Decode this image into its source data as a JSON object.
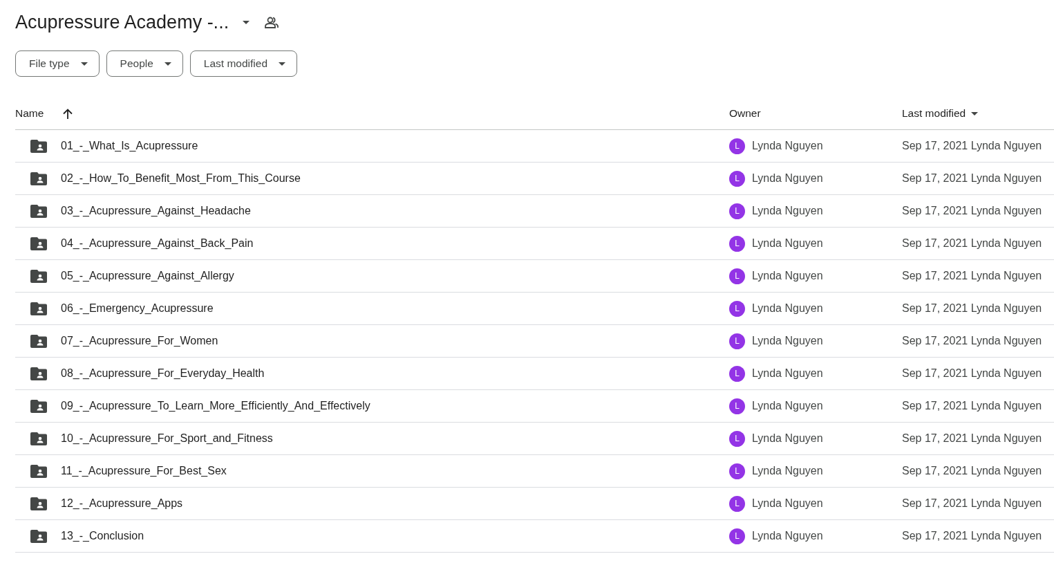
{
  "header": {
    "title": "Acupressure Academy -..."
  },
  "filters": [
    {
      "label": "File type"
    },
    {
      "label": "People"
    },
    {
      "label": "Last modified"
    }
  ],
  "table": {
    "columns": [
      "Name",
      "Owner",
      "Last modified"
    ],
    "rows": [
      {
        "name": "01_-_What_Is_Acupressure",
        "owner_initial": "L",
        "owner": "Lynda Nguyen",
        "last_modified": "Sep 17, 2021 Lynda Nguyen"
      },
      {
        "name": "02_-_How_To_Benefit_Most_From_This_Course",
        "owner_initial": "L",
        "owner": "Lynda Nguyen",
        "last_modified": "Sep 17, 2021 Lynda Nguyen"
      },
      {
        "name": "03_-_Acupressure_Against_Headache",
        "owner_initial": "L",
        "owner": "Lynda Nguyen",
        "last_modified": "Sep 17, 2021 Lynda Nguyen"
      },
      {
        "name": "04_-_Acupressure_Against_Back_Pain",
        "owner_initial": "L",
        "owner": "Lynda Nguyen",
        "last_modified": "Sep 17, 2021 Lynda Nguyen"
      },
      {
        "name": "05_-_Acupressure_Against_Allergy",
        "owner_initial": "L",
        "owner": "Lynda Nguyen",
        "last_modified": "Sep 17, 2021 Lynda Nguyen"
      },
      {
        "name": "06_-_Emergency_Acupressure",
        "owner_initial": "L",
        "owner": "Lynda Nguyen",
        "last_modified": "Sep 17, 2021 Lynda Nguyen"
      },
      {
        "name": "07_-_Acupressure_For_Women",
        "owner_initial": "L",
        "owner": "Lynda Nguyen",
        "last_modified": "Sep 17, 2021 Lynda Nguyen"
      },
      {
        "name": "08_-_Acupressure_For_Everyday_Health",
        "owner_initial": "L",
        "owner": "Lynda Nguyen",
        "last_modified": "Sep 17, 2021 Lynda Nguyen"
      },
      {
        "name": "09_-_Acupressure_To_Learn_More_Efficiently_And_Effectively",
        "owner_initial": "L",
        "owner": "Lynda Nguyen",
        "last_modified": "Sep 17, 2021 Lynda Nguyen"
      },
      {
        "name": "10_-_Acupressure_For_Sport_and_Fitness",
        "owner_initial": "L",
        "owner": "Lynda Nguyen",
        "last_modified": "Sep 17, 2021 Lynda Nguyen"
      },
      {
        "name": "11_-_Acupressure_For_Best_Sex",
        "owner_initial": "L",
        "owner": "Lynda Nguyen",
        "last_modified": "Sep 17, 2021 Lynda Nguyen"
      },
      {
        "name": "12_-_Acupressure_Apps",
        "owner_initial": "L",
        "owner": "Lynda Nguyen",
        "last_modified": "Sep 17, 2021 Lynda Nguyen"
      },
      {
        "name": "13_-_Conclusion",
        "owner_initial": "L",
        "owner": "Lynda Nguyen",
        "last_modified": "Sep 17, 2021 Lynda Nguyen"
      }
    ]
  }
}
